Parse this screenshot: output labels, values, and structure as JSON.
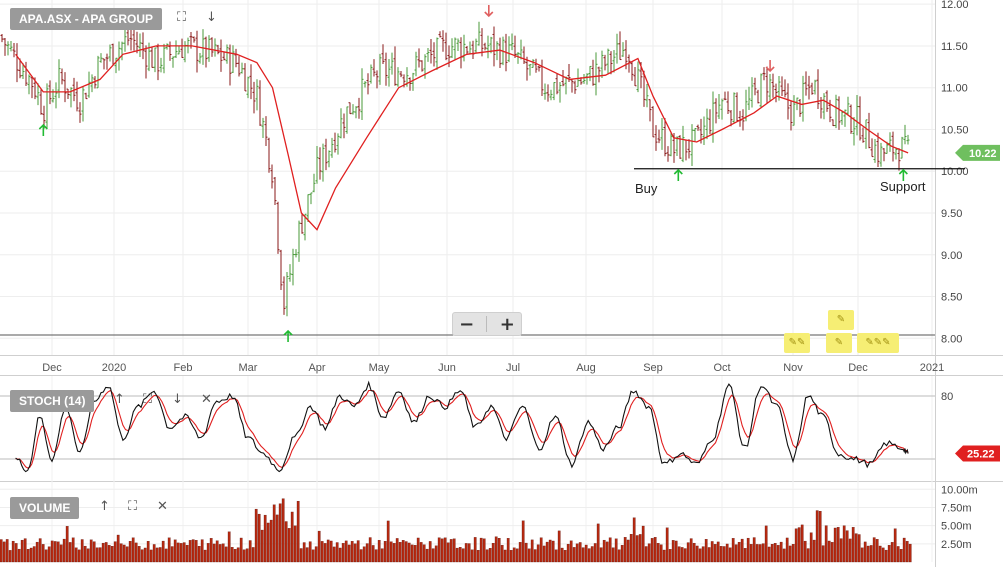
{
  "panels": {
    "price": {
      "title": "APA.ASX - APA GROUP"
    },
    "stoch": {
      "title": "STOCH (14)"
    },
    "volume": {
      "title": "VOLUME"
    }
  },
  "icons": {
    "expand": "expand-icon",
    "down": "arrow-down-icon",
    "up": "arrow-up-icon",
    "close": "close-icon"
  },
  "controls": {
    "zoom_out": "−",
    "zoom_in": "+"
  },
  "annotations": {
    "buy": "Buy",
    "support": "Support"
  },
  "colors": {
    "up_bar": "#4a9a3a",
    "down_bar": "#8a1a1a",
    "ma_line": "#e02020",
    "stoch_k": "#111111",
    "stoch_d": "#e02020",
    "volume_bar": "#b72a12",
    "last_price_tag": "#6fbf5f",
    "stoch_tag": "#e02020",
    "arrow_up": "#22bb33",
    "arrow_down": "#e06060"
  },
  "chart_data": [
    {
      "type": "candlestick",
      "title": "APA.ASX - APA GROUP",
      "x_tick_labels": [
        "Dec",
        "2020",
        "Feb",
        "Mar",
        "Apr",
        "May",
        "Jun",
        "Jul",
        "Aug",
        "Sep",
        "Oct",
        "Nov",
        "Dec",
        "2021"
      ],
      "y_tick_labels": [
        "8.00",
        "8.50",
        "9.00",
        "9.50",
        "10.00",
        "10.50",
        "11.00",
        "11.50",
        "12.00"
      ],
      "ylim": [
        7.8,
        12.05
      ],
      "last_price": "10.22",
      "support_level": 10.03,
      "horizontal_line": 8.04,
      "series": [
        {
          "name": "Price",
          "close_path_points": [
            [
              "2019-11-10",
              11.35
            ],
            [
              "2019-11-20",
              11.05
            ],
            [
              "2019-11-26",
              10.75
            ],
            [
              "2019-12-05",
              11.1
            ],
            [
              "2019-12-15",
              10.85
            ],
            [
              "2019-12-25",
              11.3
            ],
            [
              "2020-01-08",
              11.6
            ],
            [
              "2020-01-20",
              11.3
            ],
            [
              "2020-02-01",
              11.5
            ],
            [
              "2020-02-15",
              11.4
            ],
            [
              "2020-02-25",
              11.3
            ],
            [
              "2020-03-05",
              10.9
            ],
            [
              "2020-03-12",
              10.0
            ],
            [
              "2020-03-17",
              8.4
            ],
            [
              "2020-03-23",
              9.2
            ],
            [
              "2020-04-01",
              10.0
            ],
            [
              "2020-04-15",
              10.7
            ],
            [
              "2020-05-01",
              11.2
            ],
            [
              "2020-05-15",
              11.2
            ],
            [
              "2020-06-01",
              11.5
            ],
            [
              "2020-06-20",
              11.5
            ],
            [
              "2020-07-01",
              11.4
            ],
            [
              "2020-07-15",
              11.0
            ],
            [
              "2020-08-01",
              11.1
            ],
            [
              "2020-08-20",
              11.5
            ],
            [
              "2020-09-01",
              10.5
            ],
            [
              "2020-09-10",
              10.25
            ],
            [
              "2020-09-20",
              10.35
            ],
            [
              "2020-10-01",
              10.85
            ],
            [
              "2020-10-10",
              10.7
            ],
            [
              "2020-10-20",
              11.1
            ],
            [
              "2020-11-01",
              10.7
            ],
            [
              "2020-11-10",
              11.05
            ],
            [
              "2020-11-20",
              10.7
            ],
            [
              "2020-12-01",
              10.6
            ],
            [
              "2020-12-10",
              10.2
            ],
            [
              "2020-12-18",
              10.3
            ],
            [
              "2020-12-22",
              10.22
            ]
          ]
        },
        {
          "name": "MA",
          "points": [
            [
              "2019-11-10",
              11.4
            ],
            [
              "2019-11-26",
              10.95
            ],
            [
              "2019-12-10",
              10.95
            ],
            [
              "2019-12-25",
              11.1
            ],
            [
              "2020-01-05",
              11.4
            ],
            [
              "2020-01-20",
              11.5
            ],
            [
              "2020-02-05",
              11.5
            ],
            [
              "2020-02-25",
              11.4
            ],
            [
              "2020-03-05",
              11.3
            ],
            [
              "2020-03-12",
              11.0
            ],
            [
              "2020-03-19",
              10.2
            ],
            [
              "2020-03-25",
              9.5
            ],
            [
              "2020-04-01",
              9.3
            ],
            [
              "2020-04-10",
              9.8
            ],
            [
              "2020-04-25",
              10.4
            ],
            [
              "2020-05-10",
              11.0
            ],
            [
              "2020-05-25",
              11.2
            ],
            [
              "2020-06-10",
              11.4
            ],
            [
              "2020-06-25",
              11.45
            ],
            [
              "2020-07-10",
              11.3
            ],
            [
              "2020-07-25",
              11.1
            ],
            [
              "2020-08-10",
              11.15
            ],
            [
              "2020-08-25",
              11.35
            ],
            [
              "2020-09-01",
              10.9
            ],
            [
              "2020-09-10",
              10.4
            ],
            [
              "2020-09-20",
              10.35
            ],
            [
              "2020-10-01",
              10.5
            ],
            [
              "2020-10-15",
              10.7
            ],
            [
              "2020-10-25",
              10.9
            ],
            [
              "2020-11-05",
              10.8
            ],
            [
              "2020-11-15",
              10.85
            ],
            [
              "2020-11-25",
              10.7
            ],
            [
              "2020-12-05",
              10.5
            ],
            [
              "2020-12-15",
              10.3
            ],
            [
              "2020-12-22",
              10.22
            ]
          ]
        }
      ],
      "markers": [
        {
          "date": "2019-11-26",
          "type": "up"
        },
        {
          "date": "2020-03-19",
          "type": "up"
        },
        {
          "date": "2020-06-20",
          "type": "down"
        },
        {
          "date": "2020-09-12",
          "type": "up"
        },
        {
          "date": "2020-10-22",
          "type": "down"
        },
        {
          "date": "2020-12-20",
          "type": "up"
        }
      ]
    },
    {
      "type": "line",
      "title": "STOCH (14)",
      "y_tick_labels": [
        "80"
      ],
      "ylim": [
        0,
        100
      ],
      "last_value": "25.22",
      "series": [
        {
          "name": "%K",
          "points": [
            [
              "2019-11-10",
              20
            ],
            [
              "2019-11-17",
              10
            ],
            [
              "2019-11-24",
              60
            ],
            [
              "2019-12-01",
              20
            ],
            [
              "2019-12-08",
              70
            ],
            [
              "2019-12-15",
              25
            ],
            [
              "2019-12-22",
              75
            ],
            [
              "2019-12-29",
              90
            ],
            [
              "2020-01-05",
              40
            ],
            [
              "2020-01-12",
              70
            ],
            [
              "2020-01-19",
              85
            ],
            [
              "2020-01-26",
              50
            ],
            [
              "2020-02-02",
              60
            ],
            [
              "2020-02-09",
              40
            ],
            [
              "2020-02-16",
              75
            ],
            [
              "2020-02-23",
              80
            ],
            [
              "2020-03-01",
              40
            ],
            [
              "2020-03-08",
              25
            ],
            [
              "2020-03-15",
              10
            ],
            [
              "2020-03-22",
              40
            ],
            [
              "2020-03-29",
              70
            ],
            [
              "2020-04-05",
              50
            ],
            [
              "2020-04-12",
              80
            ],
            [
              "2020-04-19",
              70
            ],
            [
              "2020-04-26",
              90
            ],
            [
              "2020-05-03",
              60
            ],
            [
              "2020-05-10",
              85
            ],
            [
              "2020-05-17",
              55
            ],
            [
              "2020-05-24",
              80
            ],
            [
              "2020-05-31",
              70
            ],
            [
              "2020-06-07",
              85
            ],
            [
              "2020-06-14",
              50
            ],
            [
              "2020-06-21",
              70
            ],
            [
              "2020-06-28",
              40
            ],
            [
              "2020-07-05",
              70
            ],
            [
              "2020-07-12",
              30
            ],
            [
              "2020-07-19",
              60
            ],
            [
              "2020-07-26",
              15
            ],
            [
              "2020-08-02",
              55
            ],
            [
              "2020-08-09",
              30
            ],
            [
              "2020-08-16",
              50
            ],
            [
              "2020-08-23",
              85
            ],
            [
              "2020-08-30",
              70
            ],
            [
              "2020-09-06",
              15
            ],
            [
              "2020-09-13",
              25
            ],
            [
              "2020-09-20",
              15
            ],
            [
              "2020-09-27",
              40
            ],
            [
              "2020-10-04",
              90
            ],
            [
              "2020-10-11",
              30
            ],
            [
              "2020-10-18",
              90
            ],
            [
              "2020-10-25",
              70
            ],
            [
              "2020-11-01",
              20
            ],
            [
              "2020-11-08",
              80
            ],
            [
              "2020-11-15",
              60
            ],
            [
              "2020-11-22",
              25
            ],
            [
              "2020-11-29",
              20
            ],
            [
              "2020-12-06",
              15
            ],
            [
              "2020-12-13",
              35
            ],
            [
              "2020-12-20",
              30
            ],
            [
              "2020-12-22",
              25.22
            ]
          ]
        }
      ]
    },
    {
      "type": "bar",
      "title": "VOLUME",
      "y_tick_labels": [
        "2.50m",
        "5.00m",
        "7.50m",
        "10.00m"
      ],
      "ylim": [
        0,
        11.0
      ],
      "unit": "m"
    }
  ]
}
